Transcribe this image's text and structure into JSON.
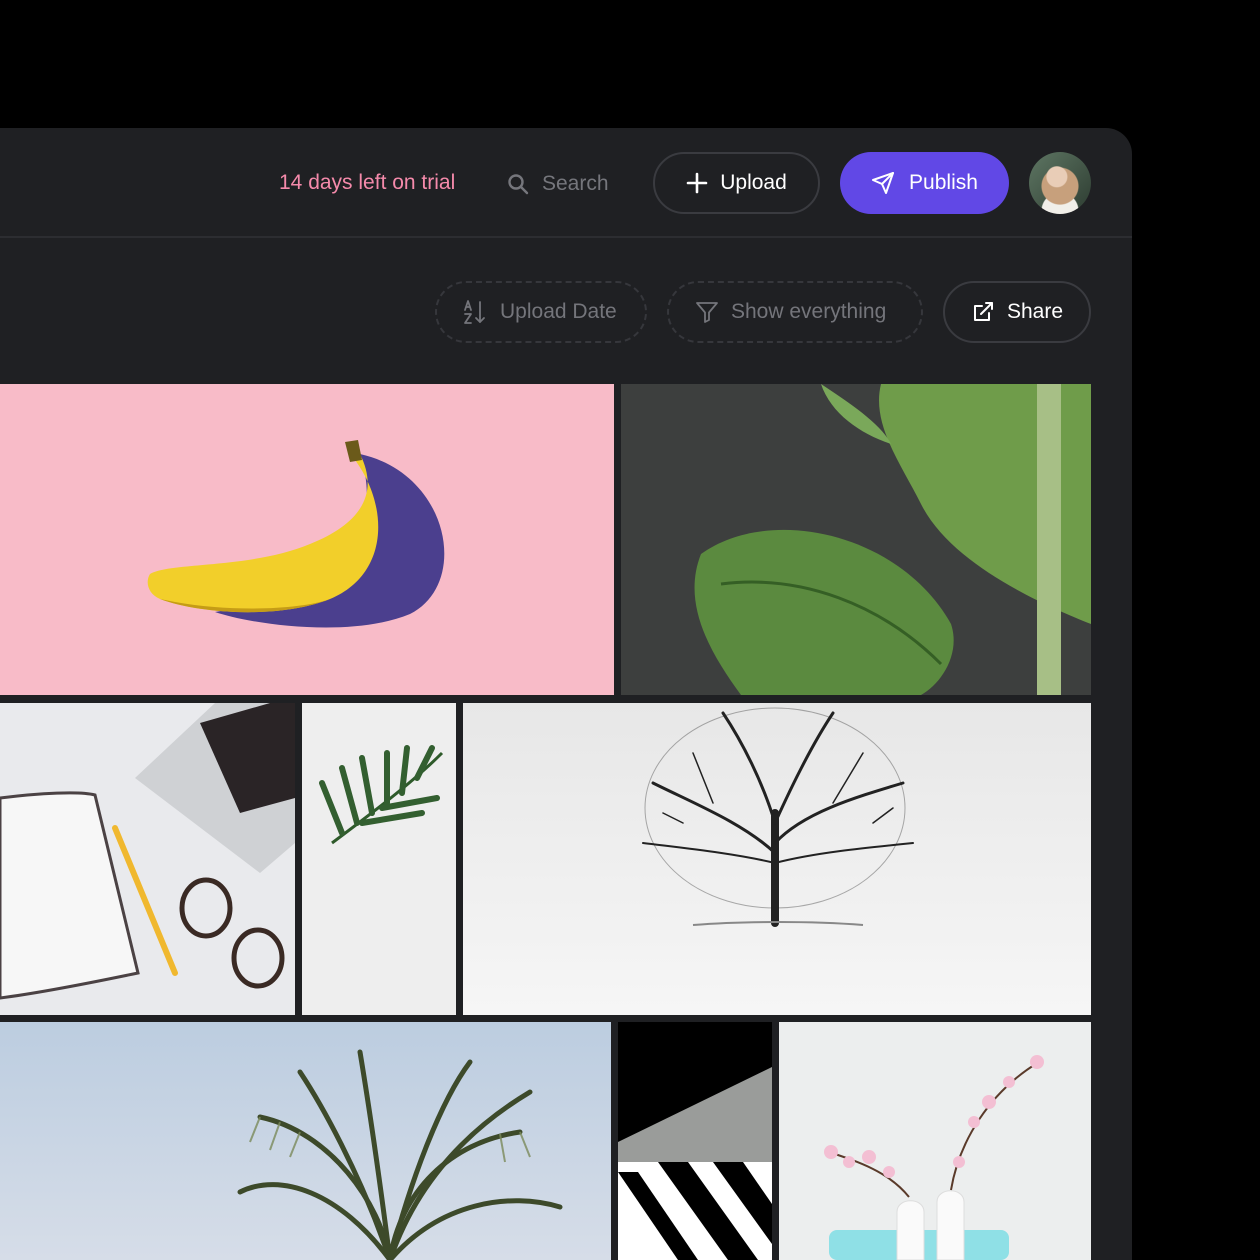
{
  "header": {
    "trial_text": "14 days left on trial",
    "search": {
      "placeholder": "Search",
      "icon": "search-icon"
    },
    "upload_label": "Upload",
    "publish_label": "Publish",
    "avatar": "user-avatar"
  },
  "toolbar": {
    "sort_label": "Upload Date",
    "filter_label": "Show everything",
    "share_label": "Share"
  },
  "colors": {
    "window_bg": "#1f2023",
    "accent": "#6148e6",
    "trial_text": "#f58aab",
    "muted_text": "#74757b"
  },
  "gallery": {
    "images": [
      "banana-photo",
      "monstera-leaf-photo",
      "desk-laptop-photo",
      "palm-leaf-photo",
      "winter-tree-photo",
      "palm-tree-photo",
      "striped-wall-photo",
      "flower-vases-photo"
    ]
  }
}
